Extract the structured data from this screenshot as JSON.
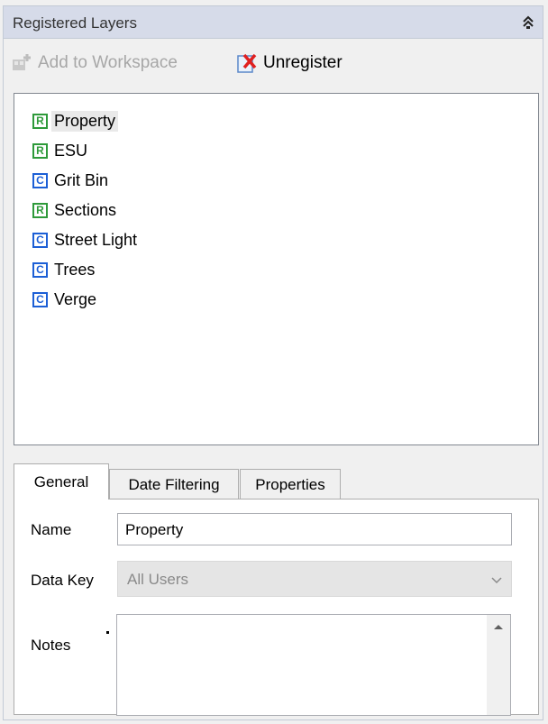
{
  "panel": {
    "title": "Registered Layers",
    "pin_icon": "double-chevron-up-icon"
  },
  "toolbar": {
    "add_label": "Add to Workspace",
    "add_enabled": false,
    "unregister_label": "Unregister"
  },
  "layers": [
    {
      "badge": "R",
      "name": "Property",
      "selected": true
    },
    {
      "badge": "R",
      "name": "ESU"
    },
    {
      "badge": "C",
      "name": "Grit Bin"
    },
    {
      "badge": "R",
      "name": "Sections"
    },
    {
      "badge": "C",
      "name": "Street Light"
    },
    {
      "badge": "C",
      "name": "Trees"
    },
    {
      "badge": "C",
      "name": "Verge"
    }
  ],
  "tabs": [
    {
      "label": "General",
      "active": true
    },
    {
      "label": "Date Filtering"
    },
    {
      "label": "Properties"
    }
  ],
  "form": {
    "name_label": "Name",
    "name_value": "Property",
    "datakey_label": "Data Key",
    "datakey_value": "All Users",
    "notes_label": "Notes",
    "notes_value": ""
  },
  "colors": {
    "badge_R": "#2e9a3a",
    "badge_C": "#1c5fd6",
    "titlebar": "#d6dbe9"
  }
}
